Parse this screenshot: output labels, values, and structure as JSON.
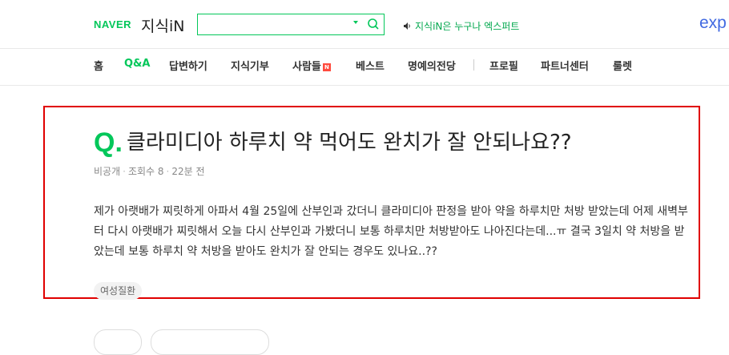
{
  "header": {
    "logo_naver": "NAVER",
    "logo_kin": "지식iN",
    "search": {
      "value": "",
      "placeholder": ""
    },
    "promo_text": "지식iN은 누구나 엑스퍼트",
    "expert_logo": "exp"
  },
  "nav": {
    "items": [
      {
        "label": "홈"
      },
      {
        "label": "Q&A",
        "active": true
      },
      {
        "label": "답변하기"
      },
      {
        "label": "지식기부"
      },
      {
        "label": "사람들",
        "badge": "N"
      },
      {
        "label": "베스트"
      },
      {
        "label": "명예의전당"
      },
      {
        "label": "프로필"
      },
      {
        "label": "파트너센터"
      },
      {
        "label": "룰렛"
      }
    ]
  },
  "question": {
    "q_prefix": "Q",
    "q_dot": ".",
    "title": "클라미디아 하루치 약 먹어도 완치가 잘 안되나요??",
    "author": "비공개",
    "views": "조회수 8",
    "time": "22분 전",
    "body": "제가 아랫배가 찌릿하게 아파서 4월 25일에 산부인과 갔더니 클라미디아 판정을 받아 약을 하루치만 처방 받았는데 어제 새벽부터 다시 아랫배가 찌릿해서 오늘 다시 산부인과 가봤더니 보통 하루치만 처방받아도 나아진다는데...ㅠ 결국 3일치 약 처방을 받았는데 보통 하루치 약 처방을 받아도 완치가 잘 안되는 경우도 있나요..??",
    "tag": "여성질환"
  },
  "colors": {
    "brand": "#03c75a",
    "highlight": "#e00000",
    "badge": "#ff4b3e"
  }
}
